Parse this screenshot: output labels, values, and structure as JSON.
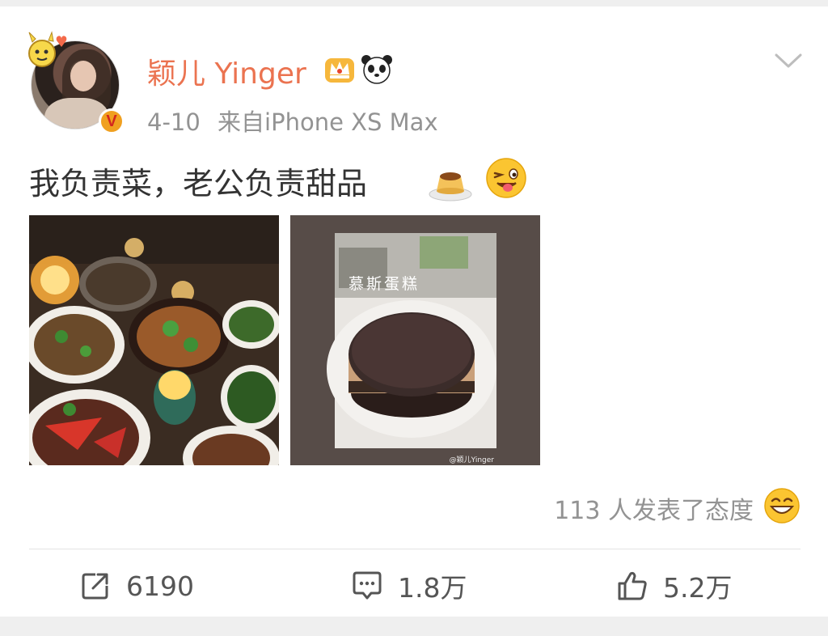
{
  "post": {
    "username": "颖儿 Yinger",
    "time": "4-10",
    "source": "来自iPhone XS Max",
    "text": "我负责菜，老公负责甜品",
    "reactions_summary": "113 人发表了态度",
    "image_2_caption": "慕斯蛋糕",
    "image_2_watermark": "@颖儿Yinger"
  },
  "icons": {
    "verified": "verified-v-badge",
    "member": "crown-icon",
    "extra_badge": "panda-icon",
    "menu": "chevron-down-icon",
    "emoji_1": "flan-emoji",
    "emoji_2": "wink-tongue-emoji",
    "reaction": "laughing-emoji"
  },
  "actions": {
    "repost_count": "6190",
    "comment_count": "1.8万",
    "like_count": "5.2万"
  },
  "colors": {
    "username": "#eb7350",
    "meta": "#939393",
    "text": "#333333"
  }
}
